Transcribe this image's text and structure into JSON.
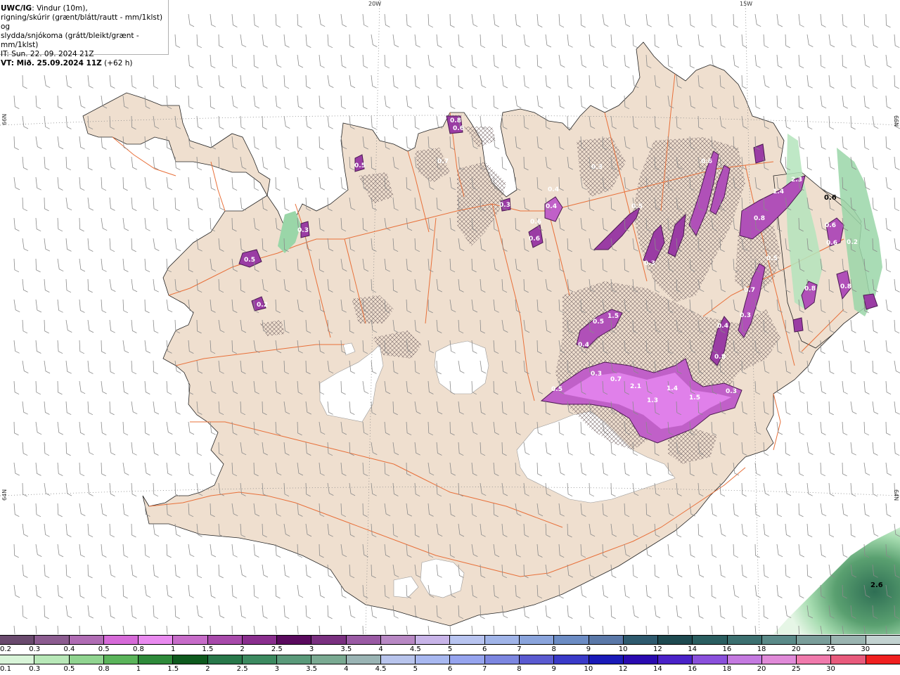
{
  "info": {
    "model": "UWC/IG",
    "line1_rest": ": Vindur (10m),",
    "line2": "rigning/skúrir (grænt/blátt/rautt - mm/1klst) og",
    "line3": "slydda/snjókoma (grátt/bleikt/grænt - mm/1klst)",
    "line4": "IT: Sun. 22. 09. 2024 21Z",
    "vt_label": "VT: Mið. 25.09.2024 11Z",
    "vt_offset": " (+62 h)"
  },
  "coords": {
    "top_20w": "20W",
    "top_15w": "15W",
    "left_66n": "66N",
    "left_64n": "64N",
    "right_66n": "66N",
    "right_64n": "64N"
  },
  "colors": {
    "land": "#efdfcf",
    "sea": "#ffffff",
    "roads": "#e8703a",
    "glacier": "#ffffff",
    "snow_accent": "#c040d0"
  },
  "snow_labels": [
    {
      "text": "0.5"
    },
    {
      "text": "0.2"
    },
    {
      "text": "0.3"
    },
    {
      "text": "0.5"
    },
    {
      "text": "0.8"
    },
    {
      "text": "0.6"
    },
    {
      "text": "0.7"
    },
    {
      "text": "0.3"
    },
    {
      "text": "0.6"
    },
    {
      "text": "0.6"
    },
    {
      "text": "0.4"
    },
    {
      "text": "0.4"
    },
    {
      "text": "0.3"
    },
    {
      "text": "0.5"
    },
    {
      "text": "0.3"
    },
    {
      "text": "1.4"
    },
    {
      "text": "2.3"
    },
    {
      "text": "0.8"
    },
    {
      "text": "0.7"
    },
    {
      "text": "0.3"
    },
    {
      "text": "0.5"
    },
    {
      "text": "1.5"
    },
    {
      "text": "0.4"
    },
    {
      "text": "0.4"
    },
    {
      "text": "0.8"
    },
    {
      "text": "0.3"
    },
    {
      "text": "0.7"
    },
    {
      "text": "2.1"
    },
    {
      "text": "1.4"
    },
    {
      "text": "1.3"
    },
    {
      "text": "1.5"
    },
    {
      "text": "0.5"
    },
    {
      "text": "0.3"
    },
    {
      "text": "0.5"
    },
    {
      "text": "0.8"
    },
    {
      "text": "0.6"
    },
    {
      "text": "0.6"
    },
    {
      "text": "0.8"
    },
    {
      "text": "0.2"
    },
    {
      "text": "0.6"
    },
    {
      "text": "2.6"
    }
  ],
  "legend_snow": {
    "colors": [
      "#6a4a6e",
      "#8c5c90",
      "#b06cb4",
      "#d66ad8",
      "#e98aef",
      "#c76cc9",
      "#a84aab",
      "#8a2e8e",
      "#5a0a5e",
      "#7a3080",
      "#9a5aa4",
      "#b888c4",
      "#c8b4e8",
      "#b8c4f0",
      "#a0b4e8",
      "#8aa4dc",
      "#6c8cc4",
      "#5a78a8",
      "#2e5a6e",
      "#1e4a50",
      "#2a5e60",
      "#3c7070",
      "#5a8a88",
      "#7a9e9a",
      "#9ab4b0",
      "#c2d2d0"
    ],
    "labels": [
      "0.2",
      "0.3",
      "0.4",
      "0.5",
      "0.8",
      "1",
      "1.5",
      "2",
      "2.5",
      "3",
      "3.5",
      "4",
      "4.5",
      "5",
      "6",
      "7",
      "8",
      "9",
      "10",
      "12",
      "14",
      "16",
      "18",
      "20",
      "25",
      "30"
    ]
  },
  "legend_rain": {
    "colors": [
      "#d8f4d8",
      "#b8e8b8",
      "#90d490",
      "#5ab45a",
      "#2e8a3a",
      "#0e5a1e",
      "#28784a",
      "#3c8a60",
      "#5a9a7a",
      "#7aaa92",
      "#9ab4b4",
      "#b8c4ec",
      "#a8b8f0",
      "#96a4ee",
      "#7c86e0",
      "#5a5ad0",
      "#3a3ac8",
      "#1a1ab8",
      "#2a0ab0",
      "#4a22c8",
      "#8a50dc",
      "#c47ae0",
      "#e08ad8",
      "#f07aac",
      "#e85a7c",
      "#f02020"
    ],
    "labels": [
      "0.1",
      "0.3",
      "0.5",
      "0.8",
      "1",
      "1.5",
      "2",
      "2.5",
      "3",
      "3.5",
      "4",
      "4.5",
      "5",
      "6",
      "7",
      "8",
      "9",
      "10",
      "12",
      "14",
      "16",
      "18",
      "20",
      "25",
      "30",
      ""
    ]
  }
}
